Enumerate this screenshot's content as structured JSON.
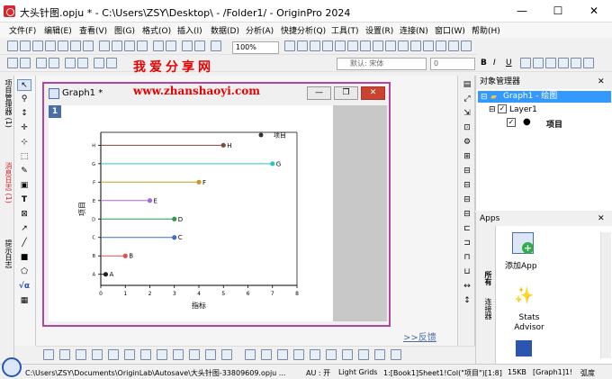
{
  "window": {
    "title": "大头针图.opju * - C:\\Users\\ZSY\\Desktop\\ - /Folder1/ - OriginPro 2024",
    "minimize": "—",
    "maximize": "☐",
    "close": "✕"
  },
  "menu": [
    "文件(F)",
    "编辑(E)",
    "查看(V)",
    "图(G)",
    "格式(O)",
    "插入(I)",
    "数据(D)",
    "分析(A)",
    "快捷分析(Q)",
    "工具(T)",
    "设置(R)",
    "连接(N)",
    "窗口(W)",
    "帮助(H)"
  ],
  "toolbar": {
    "zoom": "100%",
    "font_placeholder": "默认: 宋体",
    "font_size": "0"
  },
  "watermark": {
    "cn": "我爱分享网",
    "url": "www.zhanshaoyi.com"
  },
  "left_dock_tabs": [
    "项目管理器 (1)",
    "消息日志 (1)",
    "提示日志"
  ],
  "graph_window": {
    "title": "Graph1 *",
    "layer_number": "1"
  },
  "feedback": ">>反馈",
  "object_manager": {
    "header": "对象管理器",
    "graph": "Graph1 - 绘图",
    "layer": "Layer1",
    "plot": "项目"
  },
  "apps": {
    "header": "Apps",
    "tabs": [
      "所有",
      "连接器"
    ],
    "items": [
      "添加App",
      "Stats Advisor"
    ]
  },
  "statusbar": {
    "path": "C:\\Users\\ZSY\\Documents\\OriginLab\\Autosave\\大头针图-33809609.opju ...",
    "au": "AU : 开",
    "grid": "Light Grids",
    "sheet": "1:[Book1]Sheet1!Col(\"项目\")[1:8]",
    "size": "15KB",
    "graph": "[Graph1]1!",
    "unit": "弧度"
  },
  "chart_data": {
    "type": "lollipop",
    "categories": [
      "A",
      "B",
      "C",
      "D",
      "E",
      "F",
      "G",
      "H"
    ],
    "values": [
      0.2,
      1.0,
      3.0,
      3.0,
      2.0,
      4.0,
      7.0,
      5.0
    ],
    "colors": [
      "#222222",
      "#d9534f",
      "#3a6fc4",
      "#2e9a4a",
      "#a36ad6",
      "#c99a1a",
      "#2bc4c4",
      "#7a4a3a"
    ],
    "xlabel": "指标",
    "ylabel": "项目",
    "xlim": [
      0,
      8
    ],
    "xticks": [
      0,
      1,
      2,
      3,
      4,
      5,
      6,
      7,
      8
    ],
    "legend": "项目",
    "legend_position": "top-right"
  }
}
